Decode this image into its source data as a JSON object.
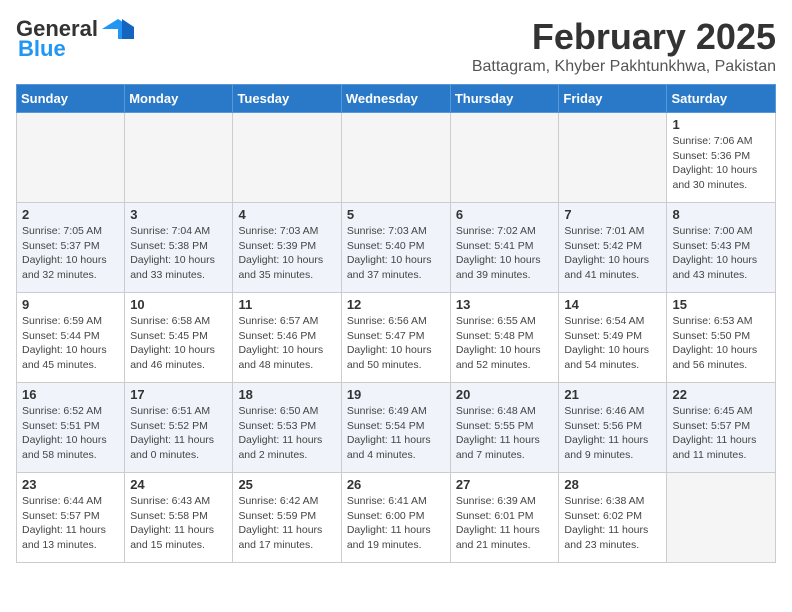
{
  "header": {
    "logo_general": "General",
    "logo_blue": "Blue",
    "month": "February 2025",
    "location": "Battagram, Khyber Pakhtunkhwa, Pakistan"
  },
  "weekdays": [
    "Sunday",
    "Monday",
    "Tuesday",
    "Wednesday",
    "Thursday",
    "Friday",
    "Saturday"
  ],
  "weeks": [
    [
      {
        "day": "",
        "info": ""
      },
      {
        "day": "",
        "info": ""
      },
      {
        "day": "",
        "info": ""
      },
      {
        "day": "",
        "info": ""
      },
      {
        "day": "",
        "info": ""
      },
      {
        "day": "",
        "info": ""
      },
      {
        "day": "1",
        "info": "Sunrise: 7:06 AM\nSunset: 5:36 PM\nDaylight: 10 hours and 30 minutes."
      }
    ],
    [
      {
        "day": "2",
        "info": "Sunrise: 7:05 AM\nSunset: 5:37 PM\nDaylight: 10 hours and 32 minutes."
      },
      {
        "day": "3",
        "info": "Sunrise: 7:04 AM\nSunset: 5:38 PM\nDaylight: 10 hours and 33 minutes."
      },
      {
        "day": "4",
        "info": "Sunrise: 7:03 AM\nSunset: 5:39 PM\nDaylight: 10 hours and 35 minutes."
      },
      {
        "day": "5",
        "info": "Sunrise: 7:03 AM\nSunset: 5:40 PM\nDaylight: 10 hours and 37 minutes."
      },
      {
        "day": "6",
        "info": "Sunrise: 7:02 AM\nSunset: 5:41 PM\nDaylight: 10 hours and 39 minutes."
      },
      {
        "day": "7",
        "info": "Sunrise: 7:01 AM\nSunset: 5:42 PM\nDaylight: 10 hours and 41 minutes."
      },
      {
        "day": "8",
        "info": "Sunrise: 7:00 AM\nSunset: 5:43 PM\nDaylight: 10 hours and 43 minutes."
      }
    ],
    [
      {
        "day": "9",
        "info": "Sunrise: 6:59 AM\nSunset: 5:44 PM\nDaylight: 10 hours and 45 minutes."
      },
      {
        "day": "10",
        "info": "Sunrise: 6:58 AM\nSunset: 5:45 PM\nDaylight: 10 hours and 46 minutes."
      },
      {
        "day": "11",
        "info": "Sunrise: 6:57 AM\nSunset: 5:46 PM\nDaylight: 10 hours and 48 minutes."
      },
      {
        "day": "12",
        "info": "Sunrise: 6:56 AM\nSunset: 5:47 PM\nDaylight: 10 hours and 50 minutes."
      },
      {
        "day": "13",
        "info": "Sunrise: 6:55 AM\nSunset: 5:48 PM\nDaylight: 10 hours and 52 minutes."
      },
      {
        "day": "14",
        "info": "Sunrise: 6:54 AM\nSunset: 5:49 PM\nDaylight: 10 hours and 54 minutes."
      },
      {
        "day": "15",
        "info": "Sunrise: 6:53 AM\nSunset: 5:50 PM\nDaylight: 10 hours and 56 minutes."
      }
    ],
    [
      {
        "day": "16",
        "info": "Sunrise: 6:52 AM\nSunset: 5:51 PM\nDaylight: 10 hours and 58 minutes."
      },
      {
        "day": "17",
        "info": "Sunrise: 6:51 AM\nSunset: 5:52 PM\nDaylight: 11 hours and 0 minutes."
      },
      {
        "day": "18",
        "info": "Sunrise: 6:50 AM\nSunset: 5:53 PM\nDaylight: 11 hours and 2 minutes."
      },
      {
        "day": "19",
        "info": "Sunrise: 6:49 AM\nSunset: 5:54 PM\nDaylight: 11 hours and 4 minutes."
      },
      {
        "day": "20",
        "info": "Sunrise: 6:48 AM\nSunset: 5:55 PM\nDaylight: 11 hours and 7 minutes."
      },
      {
        "day": "21",
        "info": "Sunrise: 6:46 AM\nSunset: 5:56 PM\nDaylight: 11 hours and 9 minutes."
      },
      {
        "day": "22",
        "info": "Sunrise: 6:45 AM\nSunset: 5:57 PM\nDaylight: 11 hours and 11 minutes."
      }
    ],
    [
      {
        "day": "23",
        "info": "Sunrise: 6:44 AM\nSunset: 5:57 PM\nDaylight: 11 hours and 13 minutes."
      },
      {
        "day": "24",
        "info": "Sunrise: 6:43 AM\nSunset: 5:58 PM\nDaylight: 11 hours and 15 minutes."
      },
      {
        "day": "25",
        "info": "Sunrise: 6:42 AM\nSunset: 5:59 PM\nDaylight: 11 hours and 17 minutes."
      },
      {
        "day": "26",
        "info": "Sunrise: 6:41 AM\nSunset: 6:00 PM\nDaylight: 11 hours and 19 minutes."
      },
      {
        "day": "27",
        "info": "Sunrise: 6:39 AM\nSunset: 6:01 PM\nDaylight: 11 hours and 21 minutes."
      },
      {
        "day": "28",
        "info": "Sunrise: 6:38 AM\nSunset: 6:02 PM\nDaylight: 11 hours and 23 minutes."
      },
      {
        "day": "",
        "info": ""
      }
    ]
  ]
}
